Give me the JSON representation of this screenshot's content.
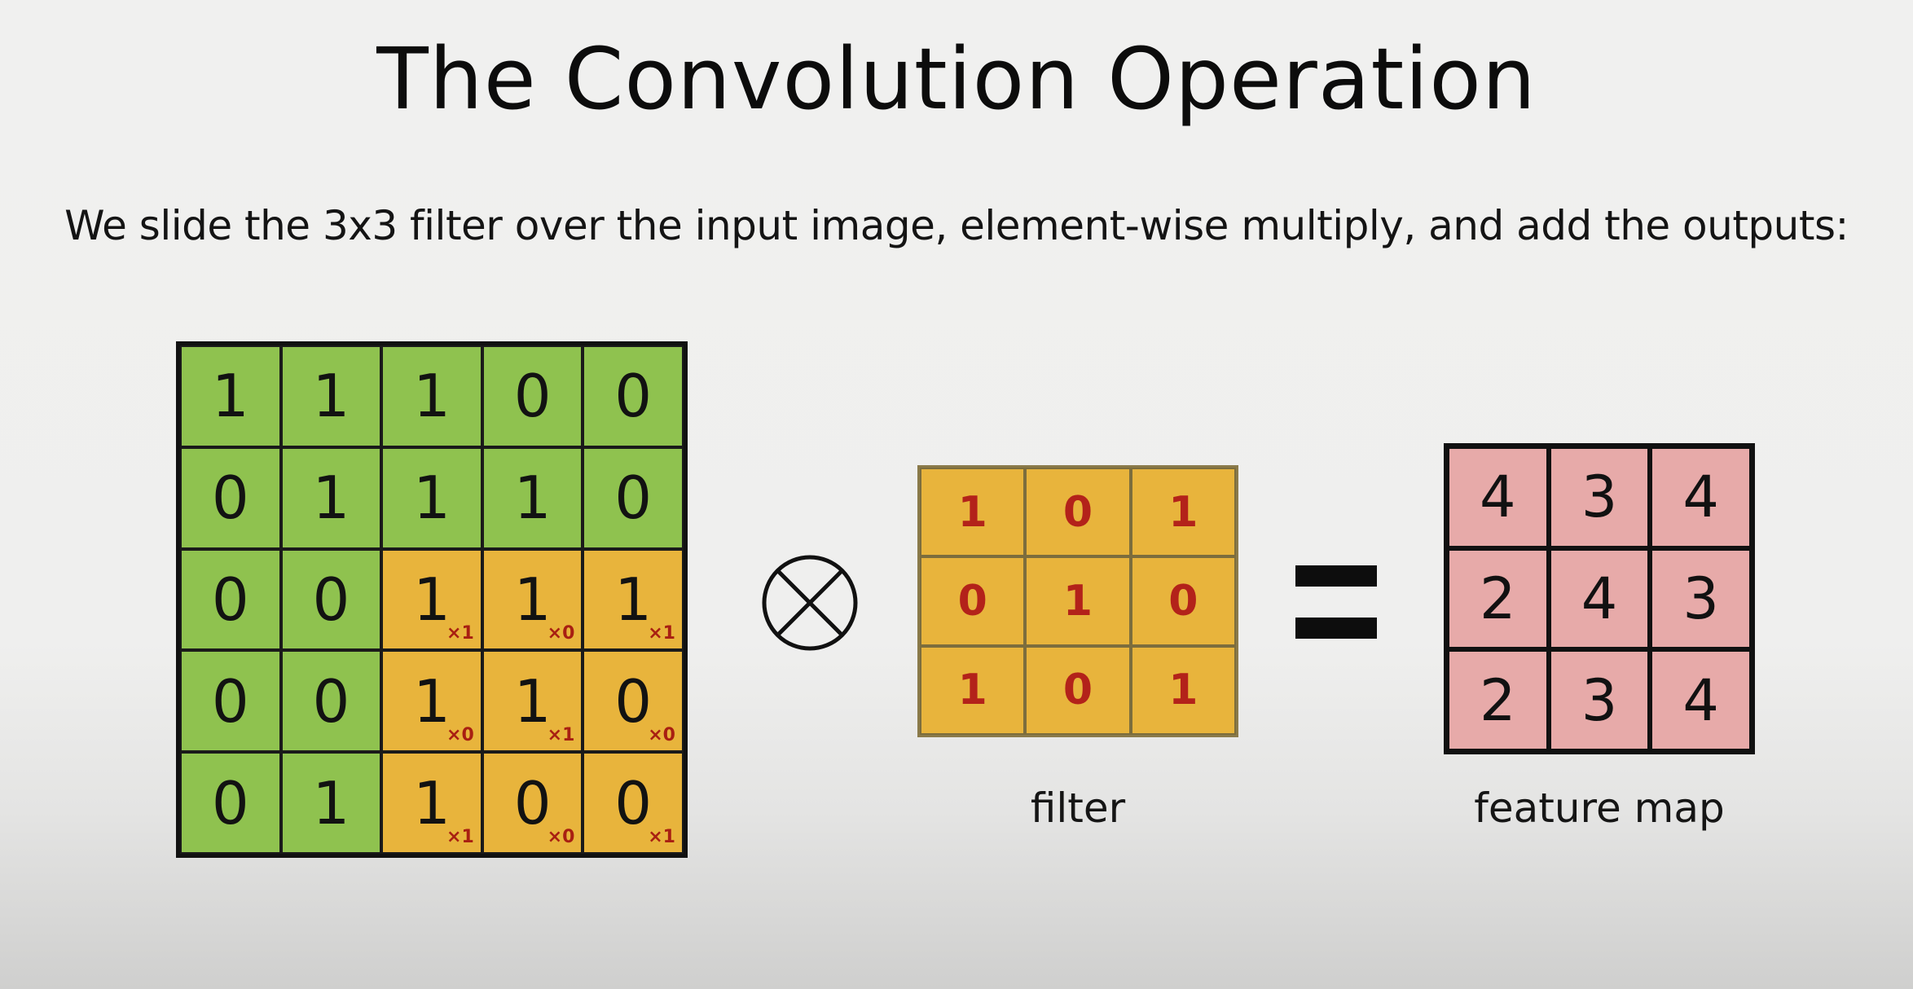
{
  "title": "The Convolution Operation",
  "subtitle": "We slide the 3x3 filter over the input image, element-wise multiply, and add the outputs:",
  "input_image": {
    "rows": [
      [
        "1",
        "1",
        "1",
        "0",
        "0"
      ],
      [
        "0",
        "1",
        "1",
        "1",
        "0"
      ],
      [
        "0",
        "0",
        "1",
        "1",
        "1"
      ],
      [
        "0",
        "0",
        "1",
        "1",
        "0"
      ],
      [
        "0",
        "1",
        "1",
        "0",
        "0"
      ]
    ],
    "multipliers": [
      [
        "",
        "",
        "",
        "",
        ""
      ],
      [
        "",
        "",
        "",
        "",
        ""
      ],
      [
        "",
        "",
        "×1",
        "×0",
        "×1"
      ],
      [
        "",
        "",
        "×0",
        "×1",
        "×0"
      ],
      [
        "",
        "",
        "×1",
        "×0",
        "×1"
      ]
    ],
    "highlight_window": {
      "row_start": 2,
      "col_start": 2,
      "size": 3
    }
  },
  "operator_symbol": "⊗",
  "filter": {
    "rows": [
      [
        "1",
        "0",
        "1"
      ],
      [
        "0",
        "1",
        "0"
      ],
      [
        "1",
        "0",
        "1"
      ]
    ],
    "label": "filter"
  },
  "equals_symbol": "=",
  "feature_map": {
    "rows": [
      [
        "4",
        "3",
        "4"
      ],
      [
        "2",
        "4",
        "3"
      ],
      [
        "2",
        "3",
        "4"
      ]
    ],
    "label": "feature map"
  },
  "colors": {
    "input_green": "#8fc24f",
    "window_orange": "#e8b43c",
    "filter_orange": "#e8b43c",
    "feature_pink": "#e7aaa9",
    "multiplier_red": "#a81f12",
    "filter_text_red": "#b3221a"
  }
}
